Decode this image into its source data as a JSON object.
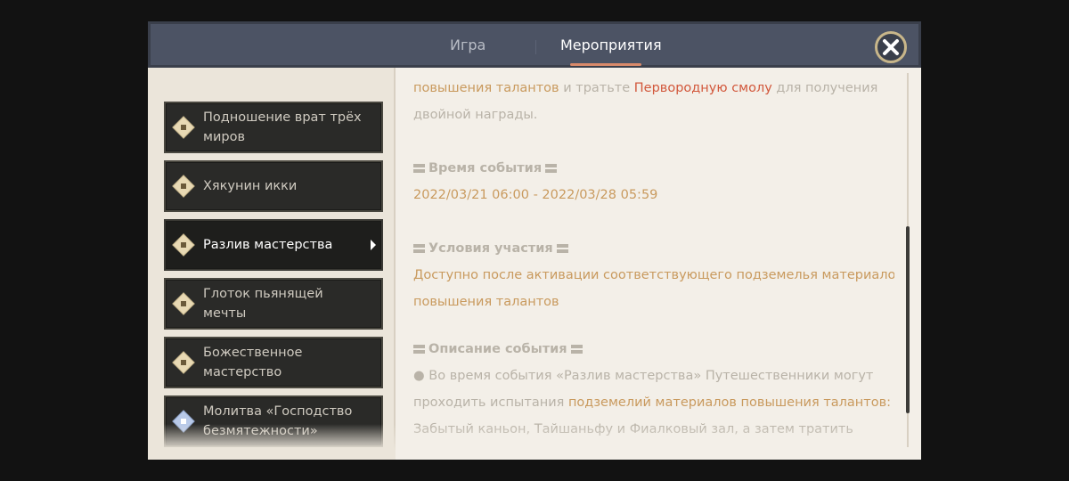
{
  "tabs": [
    {
      "label": "Игра",
      "active": false
    },
    {
      "label": "Мероприятия",
      "active": true
    }
  ],
  "close_icon": "close-x-icon",
  "events": [
    {
      "label": "Подношение врат трёх миров",
      "icon": "flag-diamond-icon",
      "selected": false
    },
    {
      "label": "Хякунин икки",
      "icon": "flag-diamond-icon",
      "selected": false
    },
    {
      "label": "Разлив мастерства",
      "icon": "flag-diamond-icon",
      "selected": true
    },
    {
      "label": "Глоток пьянящей мечты",
      "icon": "flag-diamond-icon",
      "selected": false
    },
    {
      "label": "Божественное мастерство",
      "icon": "flag-diamond-icon",
      "selected": false
    },
    {
      "label": "Молитва «Господство безмятежности»",
      "icon": "star-diamond-icon",
      "selected": false
    }
  ],
  "content": {
    "intro_gold": "повышения талантов",
    "intro_mid": " и тратьте ",
    "intro_red": "Первородную смолу",
    "intro_end": " для получения",
    "intro_line2": "двойной награды.",
    "time_title": "Время события",
    "time_value": "2022/03/21 06:00 - 2022/03/28 05:59",
    "cond_title": "Условия участия",
    "cond_line1": "Доступно после активации соответствующего подземелья материалов",
    "cond_line2": "повышения талантов",
    "desc_title": "Описание события",
    "desc_line1": "● Во время события «Разлив мастерства» Путешественники могут",
    "desc_line2_a": "проходить испытания ",
    "desc_line2_gold": "подземелий материалов повышения талантов:",
    "desc_line3": "Забытый каньон, Тайшаньфу и Фиалковый зал, а затем тратить"
  },
  "colors": {
    "header": "#4c5364",
    "accent_gold": "#c99a5e",
    "accent_red": "#d2583c",
    "tab_underline": "#d98a6a",
    "panel_bg": "#f3efe8"
  }
}
